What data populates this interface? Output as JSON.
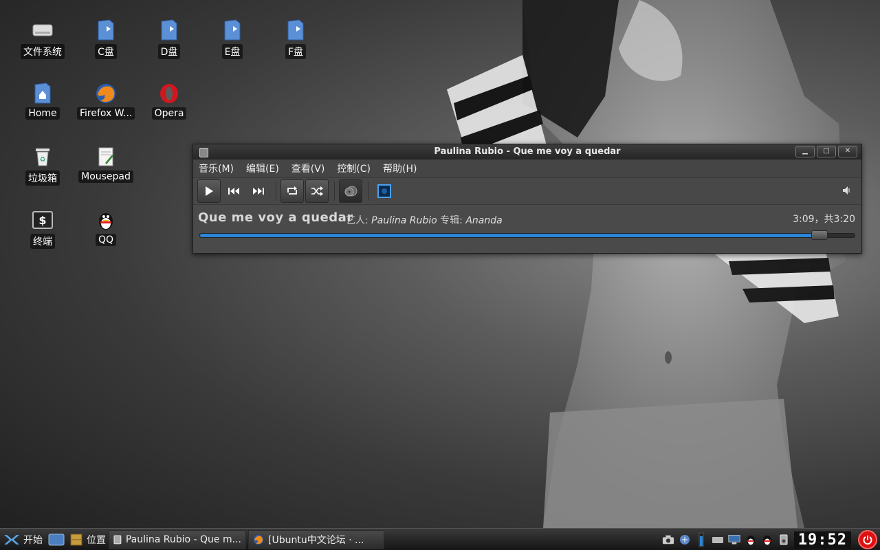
{
  "desktop": {
    "icons": [
      {
        "label": "文件系统"
      },
      {
        "label": "C盘"
      },
      {
        "label": "D盘"
      },
      {
        "label": "E盘"
      },
      {
        "label": "F盘"
      },
      {
        "label": "Home"
      },
      {
        "label": "Firefox W..."
      },
      {
        "label": "Opera"
      },
      {
        "label": "垃圾箱"
      },
      {
        "label": "Mousepad"
      },
      {
        "label": "终端"
      },
      {
        "label": "QQ"
      }
    ]
  },
  "player": {
    "window_title": "Paulina Rubio - Que me voy a quedar",
    "menu": [
      "音乐(M)",
      "编辑(E)",
      "查看(V)",
      "控制(C)",
      "帮助(H)"
    ],
    "song_title": "Que me voy a quedar",
    "artist_label": "艺人:",
    "artist": "Paulina Rubio",
    "album_label": "专辑:",
    "album": "Ananda",
    "time": "3:09，共3:20",
    "progress_fraction": 0.945,
    "accent_color": "#2b86d8"
  },
  "taskbar": {
    "start_label": "开始",
    "places_label": "位置",
    "tasks": [
      {
        "label": "Paulina Rubio - Que m..."
      },
      {
        "label": "[Ubuntu中文论坛 · ..."
      }
    ],
    "clock": "19:52"
  }
}
